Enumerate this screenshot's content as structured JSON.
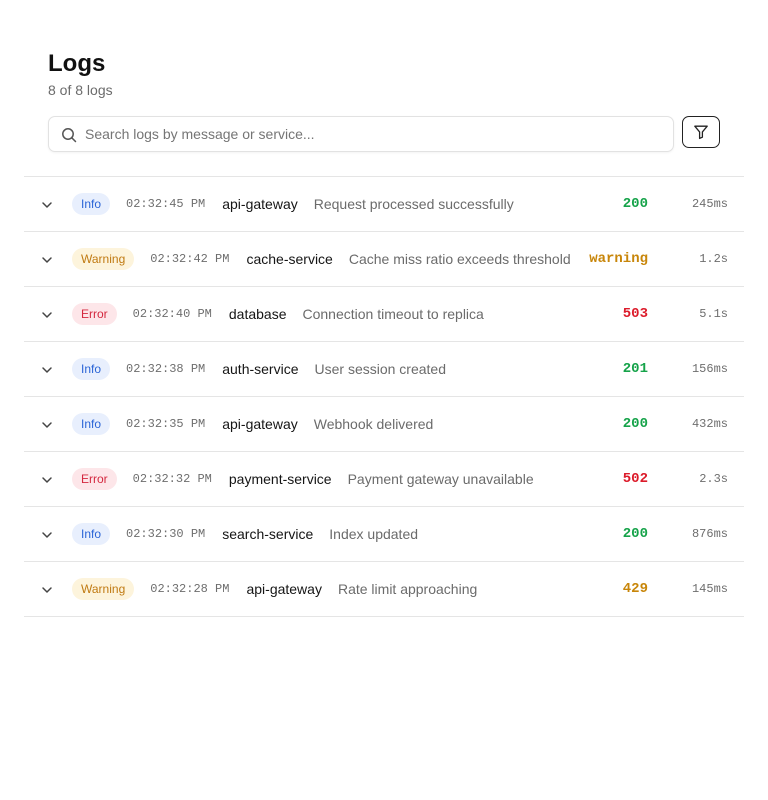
{
  "header": {
    "title": "Logs",
    "subtitle": "8 of 8 logs"
  },
  "search": {
    "placeholder": "Search logs by message or service...",
    "value": "",
    "icon": "search-icon"
  },
  "filter_button": {
    "icon": "filter-icon"
  },
  "status_colors": {
    "success": "#16a34a",
    "warning": "#c8860a",
    "error": "#dc1b2a"
  },
  "logs": [
    {
      "level": "Info",
      "time": "02:32:45 PM",
      "service": "api-gateway",
      "message": "Request processed successfully",
      "status": "200",
      "duration": "245ms"
    },
    {
      "level": "Warning",
      "time": "02:32:42 PM",
      "service": "cache-service",
      "message": "Cache miss ratio exceeds threshold",
      "status": "warning",
      "duration": "1.2s"
    },
    {
      "level": "Error",
      "time": "02:32:40 PM",
      "service": "database",
      "message": "Connection timeout to replica",
      "status": "503",
      "duration": "5.1s"
    },
    {
      "level": "Info",
      "time": "02:32:38 PM",
      "service": "auth-service",
      "message": "User session created",
      "status": "201",
      "duration": "156ms"
    },
    {
      "level": "Info",
      "time": "02:32:35 PM",
      "service": "api-gateway",
      "message": "Webhook delivered",
      "status": "200",
      "duration": "432ms"
    },
    {
      "level": "Error",
      "time": "02:32:32 PM",
      "service": "payment-service",
      "message": "Payment gateway unavailable",
      "status": "502",
      "duration": "2.3s"
    },
    {
      "level": "Info",
      "time": "02:32:30 PM",
      "service": "search-service",
      "message": "Index updated",
      "status": "200",
      "duration": "876ms"
    },
    {
      "level": "Warning",
      "time": "02:32:28 PM",
      "service": "api-gateway",
      "message": "Rate limit approaching",
      "status": "429",
      "duration": "145ms"
    }
  ]
}
